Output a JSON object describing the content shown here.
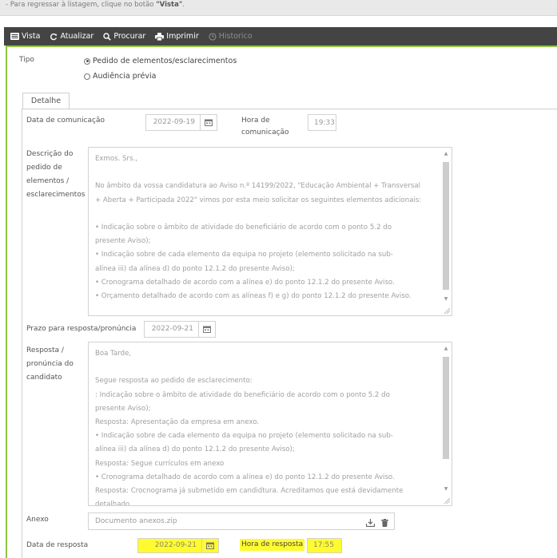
{
  "top_note": {
    "prefix": "- Para regressar à listagem, clique no botão ",
    "button_ref": "\"Vista\"",
    "suffix": "."
  },
  "toolbar": {
    "vista": "Vista",
    "atualizar": "Atualizar",
    "procurar": "Procurar",
    "imprimir": "Imprimir",
    "historico": "Historico"
  },
  "tipo": {
    "label": "Tipo",
    "options": [
      {
        "label": "Pedido de elementos/esclarecimentos",
        "selected": true
      },
      {
        "label": "Audiência prévia",
        "selected": false
      }
    ]
  },
  "tabs": [
    {
      "label": "Detalhe",
      "active": true
    }
  ],
  "detail": {
    "data_comunicacao_label": "Data de comunicação",
    "data_comunicacao_value": "2022-09-19",
    "hora_comunicacao_label": "Hora de comunicação",
    "hora_comunicacao_value": "19:33",
    "descricao_label": "Descrição do pedido de elementos / esclarecimentos",
    "descricao_lines": [
      "Exmos. Srs.,",
      "",
      "No âmbito da vossa candidatura ao Aviso n.º 14199/2022, \"Educação Ambiental + Transversal",
      "+ Aberta + Participada 2022\" vimos por esta meio solicitar os seguintes elementos adicionais:",
      "",
      "•    Indicação sobre o âmbito de atividade do beneficiário de acordo com o ponto 5.2 do",
      "presente Aviso);",
      "•    Indicação sobre de cada elemento da equipa no projeto (elemento solicitado na sub-",
      "alínea iii) da alínea d) do ponto 12.1.2 do presente Aviso);",
      "•    Cronograma detalhado de acordo com a alínea e) do ponto 12.1.2 do presente Aviso.",
      "•    Orçamento detalhado de acordo com as alíneas f) e g) do ponto 12.1.2 do presente Aviso."
    ],
    "prazo_label": "Prazo para resposta/pronúncia",
    "prazo_value": "2022-09-21",
    "resposta_label": "Resposta / pronúncia do candidato",
    "resposta_lines": [
      "Boa Tarde,",
      "",
      "Segue resposta ao pedido de esclarecimento:",
      ": Indicação sobre o âmbito de atividade do beneficiário de acordo com o ponto 5.2 do",
      "presente Aviso);",
      "Resposta: Apresentação da empresa em anexo.",
      "•    Indicação sobre de cada elemento da equipa no projeto (elemento solicitado na sub-",
      "alínea iii) da alínea d) do ponto 12.1.2 do presente Aviso);",
      "Resposta: Segue currículos em anexo",
      "•    Cronograma detalhado de acordo com a alínea e) do ponto 12.1.2 do presente Aviso.",
      "Resposta: Crocnograma já submetido em candidtura. Acreditamos que está devidamente",
      "detalhado."
    ],
    "anexo_label": "Anexo",
    "anexo_value": "Documento anexos.zip",
    "data_resposta_label": "Data de resposta",
    "data_resposta_value": "2022-09-21",
    "hora_resposta_label": "Hora de resposta",
    "hora_resposta_value": "17:55",
    "highlight_color": "#fffb2f",
    "frame_color": "#8fc63f"
  }
}
